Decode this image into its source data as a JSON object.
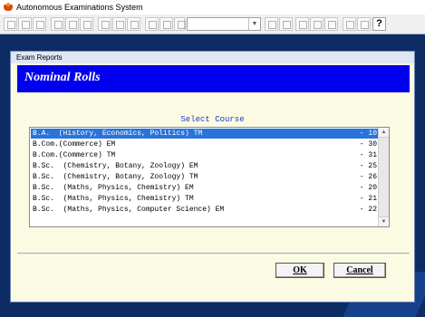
{
  "app": {
    "title": "Autonomous Examinations System",
    "help_glyph": "?"
  },
  "dialog": {
    "caption": "Exam Reports",
    "header": "Nominal Rolls",
    "select_label": "Select Course",
    "courses": [
      {
        "name": "B.A.  (History, Economics, Politics) TM",
        "code": "- 10",
        "selected": true
      },
      {
        "name": "B.Com.(Commerce) EM",
        "code": "- 30",
        "selected": false
      },
      {
        "name": "B.Com.(Commerce) TM",
        "code": "- 31",
        "selected": false
      },
      {
        "name": "B.Sc.  (Chemistry, Botany, Zoology) EM",
        "code": "- 25",
        "selected": false
      },
      {
        "name": "B.Sc.  (Chemistry, Botany, Zoology) TM",
        "code": "- 26",
        "selected": false
      },
      {
        "name": "B.Sc.  (Maths, Physics, Chemistry) EM",
        "code": "- 20",
        "selected": false
      },
      {
        "name": "B.Sc.  (Maths, Physics, Chemistry) TM",
        "code": "- 21",
        "selected": false
      },
      {
        "name": "B.Sc.  (Maths, Physics, Computer Science) EM",
        "code": "- 22",
        "selected": false
      }
    ],
    "ok_label": "OK",
    "cancel_label": "Cancel"
  },
  "colors": {
    "header_band": "#0000ee",
    "selection": "#2a73d8",
    "select_label": "#1a3ccf"
  }
}
